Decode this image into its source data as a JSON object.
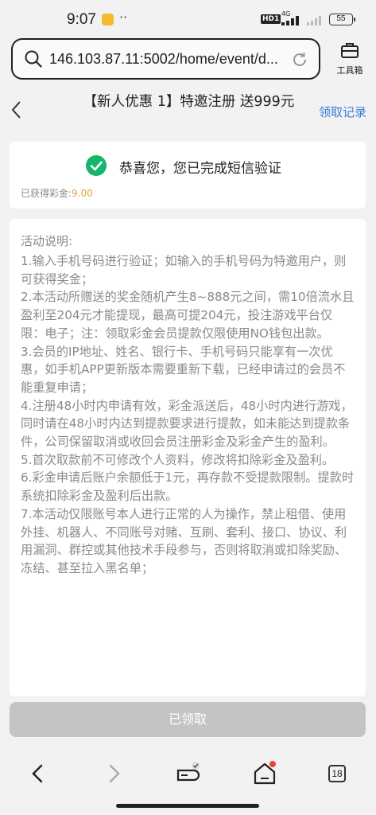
{
  "status": {
    "time": "9:07",
    "hd_badge": "HD1",
    "network": "4G",
    "battery": "55"
  },
  "browser": {
    "url": "146.103.87.11:5002/home/event/d...",
    "toolbox_label": "工具箱"
  },
  "header": {
    "title": "【新人优惠 1】特邀注册 送999元",
    "records_label": "领取记录"
  },
  "success_card": {
    "message": "恭喜您，您已完成短信验证",
    "bonus_label": "已获得彩金:",
    "bonus_value": "9.00"
  },
  "rules": {
    "title": "活动说明:",
    "items": [
      "1.输入手机号码进行验证；如输入的手机号码为特邀用户，则可获得奖金；",
      "2.本活动所赠送的奖金随机产生8~888元之间，需10倍流水且盈利至204元才能提现，最高可提204元，投注游戏平台仅限：电子；注：领取彩金会员提款仅限使用NO钱包出款。",
      "3.会员的IP地址、姓名、银行卡、手机号码只能享有一次优惠，如手机APP更新版本需要重新下载，已经申请过的会员不能重复申请；",
      "4.注册48小时内申请有效，彩金派送后，48小时内进行游戏，同时请在48小时内达到提款要求进行提款，如未能达到提款条件，公司保留取消或收回会员注册彩金及彩金产生的盈利。",
      "5.首次取款前不可修改个人资料，修改将扣除彩金及盈利。",
      "6.彩金申请后账户余额低于1元，再存款不受提款限制。提款时系统扣除彩金及盈利后出款。",
      "7.本活动仅限账号本人进行正常的人为操作，禁止租借、使用外挂、机器人、不同账号对赌、互刷、套利、接口、协议、利用漏洞、群控或其他技术手段参与，否则将取消或扣除奖励、冻结、甚至拉入黑名单；"
    ]
  },
  "footer": {
    "claimed_label": "已领取",
    "tab_count": "18"
  },
  "colors": {
    "accent_green": "#16b56b",
    "link_blue": "#3c7bd8",
    "bonus_orange": "#e6a23c"
  }
}
